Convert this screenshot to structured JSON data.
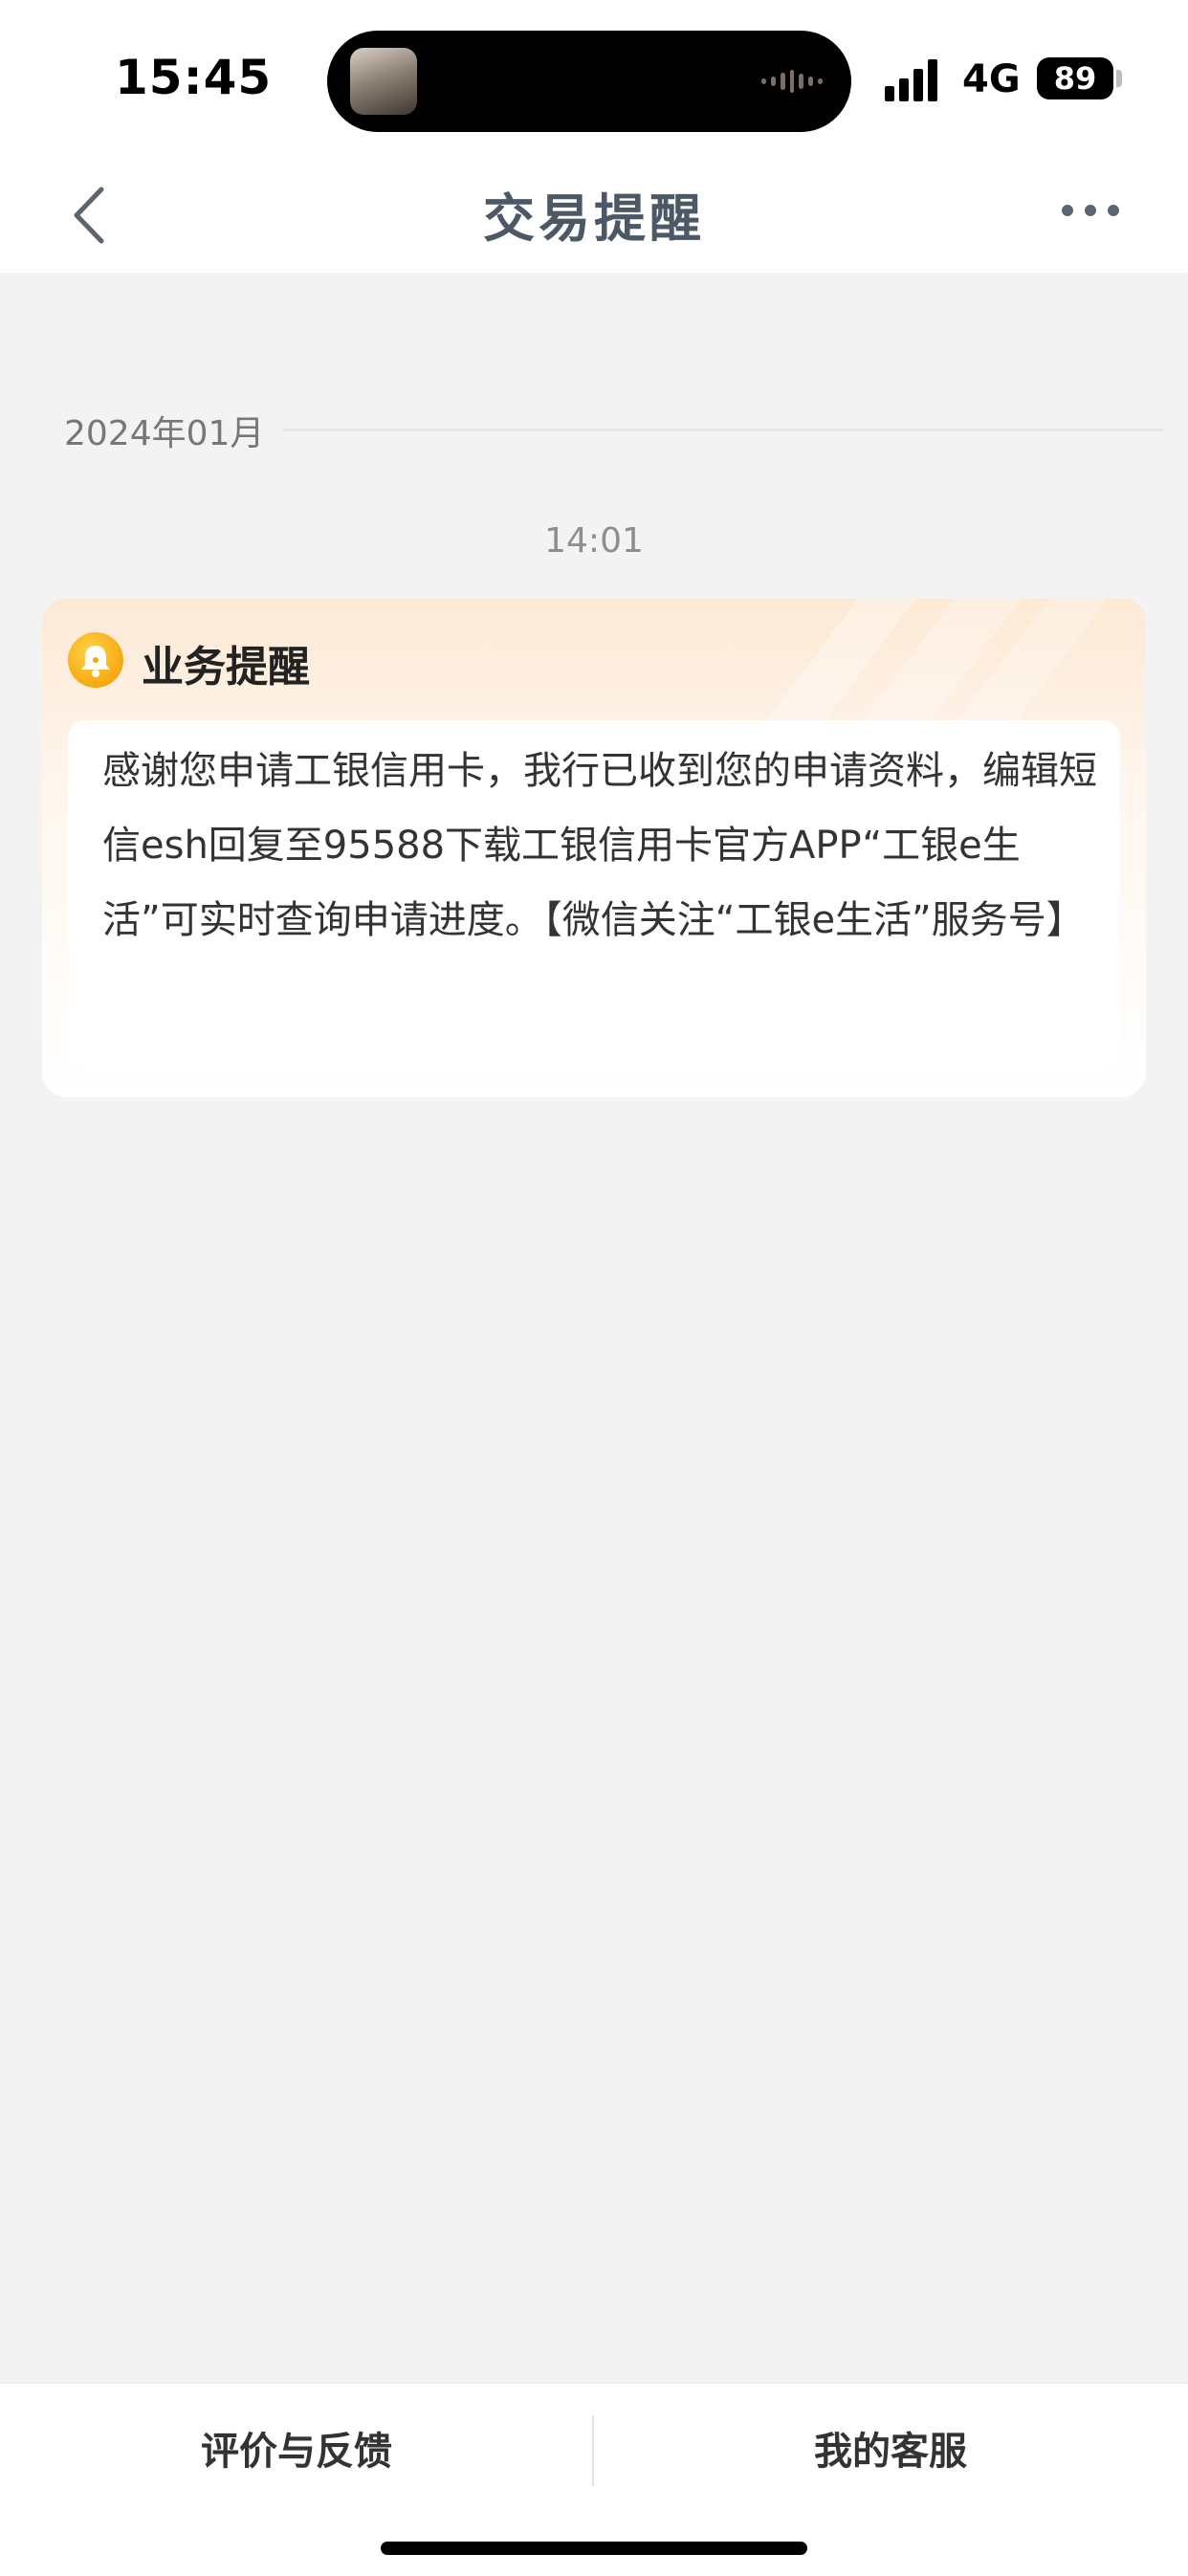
{
  "status_bar": {
    "time": "15:45",
    "network": "4G",
    "battery": "89"
  },
  "nav": {
    "title": "交易提醒",
    "back_icon": "chevron-left-icon",
    "more_icon": "more-dots-icon"
  },
  "conversation": {
    "date_divider": "2024年01月",
    "message_time": "14:01",
    "card": {
      "icon": "bell-icon",
      "title": "业务提醒",
      "body": "感谢您申请工银信用卡，我行已收到您的申请资料，编辑短信esh回复至95588下载工银信用卡官方APP“工银e生活”可实时查询申请进度。【微信关注“工银e生活”服务号】"
    }
  },
  "bottom_bar": {
    "feedback_label": "评价与反馈",
    "service_label": "我的客服"
  }
}
